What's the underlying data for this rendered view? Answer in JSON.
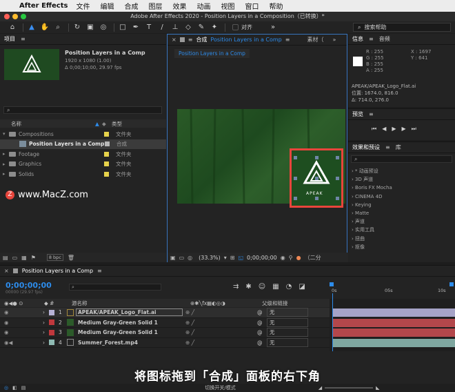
{
  "menubar": {
    "app": "After Effects",
    "items": [
      "文件",
      "编辑",
      "合成",
      "图层",
      "效果",
      "动画",
      "视图",
      "窗口",
      "帮助"
    ]
  },
  "titlebar": {
    "title": "Adobe After Effects 2020 - Position Layers in a Composition（已转换）*"
  },
  "toolbar": {
    "align_label": "对齐",
    "search_placeholder": "搜索帮助"
  },
  "project": {
    "tab": "项目",
    "comp_name": "Position Layers in a Comp",
    "comp_size": "1920 x 1080 (1.00)",
    "comp_duration": "Δ 0;00;10;00, 29.97 fps",
    "col_name": "名称",
    "col_type": "类型",
    "items": [
      {
        "name": "Compositions",
        "type": "文件夹"
      },
      {
        "name": "Position Layers in a Comp",
        "type": "合成"
      },
      {
        "name": "Footage",
        "type": "文件夹"
      },
      {
        "name": "Graphics",
        "type": "文件夹"
      },
      {
        "name": "Solids",
        "type": "文件夹"
      }
    ],
    "bpc": "8 bpc",
    "watermark": "www.MacZ.com"
  },
  "composition": {
    "tab_label": "合成",
    "tab_name": "Position Layers in a Comp",
    "other_tab": "素材（",
    "sub_tab": "Position Layers in a Comp",
    "zoom": "(33.3%)",
    "time": "0;00;00;00",
    "view_label": "（二分",
    "logo_text": "APEAK"
  },
  "info": {
    "tabs": [
      "信息",
      "音频"
    ],
    "r": "R : 255",
    "g": "G : 255",
    "b": "B : 255",
    "a": "A : 255",
    "x": "X : 1697",
    "y": "Y :   641",
    "file": "APEAK/APEAK_Logo_Flat.ai",
    "position": "位置: 1674.0, 816.0",
    "delta": "Δ: 714.0, 276.0"
  },
  "preview": {
    "tab": "预览"
  },
  "effects": {
    "tabs": [
      "效果和预设",
      "库"
    ],
    "items": [
      "* 动画预设",
      "3D 声道",
      "Boris FX Mocha",
      "CINEMA 4D",
      "Keying",
      "Matte",
      "声道",
      "实用工具",
      "扭曲",
      "抠像"
    ]
  },
  "timeline": {
    "tab": "Position Layers in a Comp",
    "timecode": "0;00;00;00",
    "fps_label": "00000 (29.97 fps)",
    "col_source": "源名称",
    "col_parent": "父级和链接",
    "ruler": [
      "0s",
      "05s",
      "10s"
    ],
    "layers": [
      {
        "num": "1",
        "name": "APEAK/APEAK_Logo_Flat.ai",
        "parent": "无",
        "color": "#b5b1d4",
        "track": "#a6a3c7"
      },
      {
        "num": "2",
        "name": "Medium Gray-Green Solid 1",
        "parent": "无",
        "color": "#c0383d",
        "track": "#b3474b"
      },
      {
        "num": "3",
        "name": "Medium Gray-Green Solid 1",
        "parent": "无",
        "color": "#c0383d",
        "track": "#b3474b"
      },
      {
        "num": "4",
        "name": "Summer_Forest.mp4",
        "parent": "无",
        "color": "#8fbab3",
        "track": "#7fa7a0"
      }
    ],
    "switch_label": "切换开关/模式"
  },
  "caption": "将图标拖到「合成」面板的右下角",
  "colors": {
    "accent": "#2d8ceb",
    "highlight": "#e8453c"
  }
}
